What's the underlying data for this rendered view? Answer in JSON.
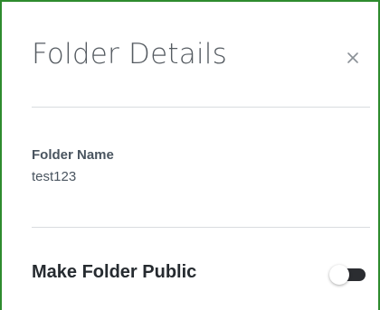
{
  "panel": {
    "title": "Folder Details",
    "close_icon": "close-icon",
    "border_color": "#2e8b2e"
  },
  "folder_name": {
    "label": "Folder Name",
    "value": "test123"
  },
  "make_public": {
    "label": "Make Folder Public",
    "enabled": false,
    "track_color": "#2b2d31"
  }
}
